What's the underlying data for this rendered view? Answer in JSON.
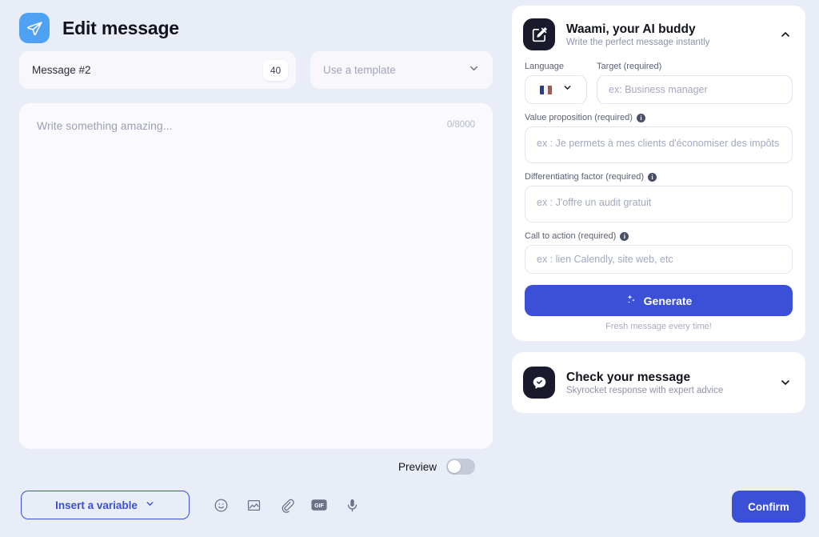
{
  "header": {
    "title": "Edit message",
    "logo_icon": "send-plane-icon",
    "logo_color": "#4ea1f3"
  },
  "message_name": {
    "value": "Message #2",
    "char_badge": "40"
  },
  "template": {
    "placeholder": "Use a template",
    "chevron_icon": "chevron-down-icon"
  },
  "editor": {
    "placeholder": "Write something amazing...",
    "counter": "0/8000"
  },
  "preview": {
    "label": "Preview",
    "enabled": false
  },
  "bottom_bar": {
    "insert_variable_label": "Insert a variable",
    "insert_variable_chevron": "chevron-down-icon",
    "icons": [
      {
        "name": "emoji-icon",
        "label": "Emoji"
      },
      {
        "name": "image-icon",
        "label": "Image"
      },
      {
        "name": "attachment-icon",
        "label": "Attachment"
      },
      {
        "name": "gif-icon",
        "label": "GIF"
      },
      {
        "name": "microphone-icon",
        "label": "Voice note"
      }
    ],
    "confirm_label": "Confirm"
  },
  "ai_card": {
    "icon": "edit-square-icon",
    "title": "Waami, your AI buddy",
    "subtitle": "Write the perfect message instantly",
    "chevron_icon": "chevron-up-icon",
    "language_label": "Language",
    "language_flag": "flag-france-icon",
    "target_label": "Target (required)",
    "target_placeholder": "ex: Business manager",
    "value_proposition_label": "Value proposition (required)",
    "value_proposition_placeholder": "ex : Je permets à mes clients d'économiser des impôts",
    "differentiating_label": "Differentiating factor (required)",
    "differentiating_placeholder": "ex : J'offre un audit gratuit",
    "cta_label": "Call to action (required)",
    "cta_placeholder": "ex : lien Calendly, site web, etc",
    "generate_label": "Generate",
    "generate_icon": "sparkles-icon",
    "generate_note": "Fresh message every time!",
    "info_icon": "info-icon"
  },
  "check_card": {
    "icon": "chat-check-icon",
    "title": "Check your message",
    "subtitle": "Skyrocket response with expert advice",
    "chevron_icon": "chevron-down-icon"
  },
  "colors": {
    "page_background": "#e9edf8",
    "accent_blue": "#3b50d6",
    "logo_blue": "#4ea1f3",
    "card_white": "#ffffff",
    "field_gray": "#f8f8fc",
    "editor_bg": "#faf9fd",
    "dark_tile": "#191b2c"
  }
}
